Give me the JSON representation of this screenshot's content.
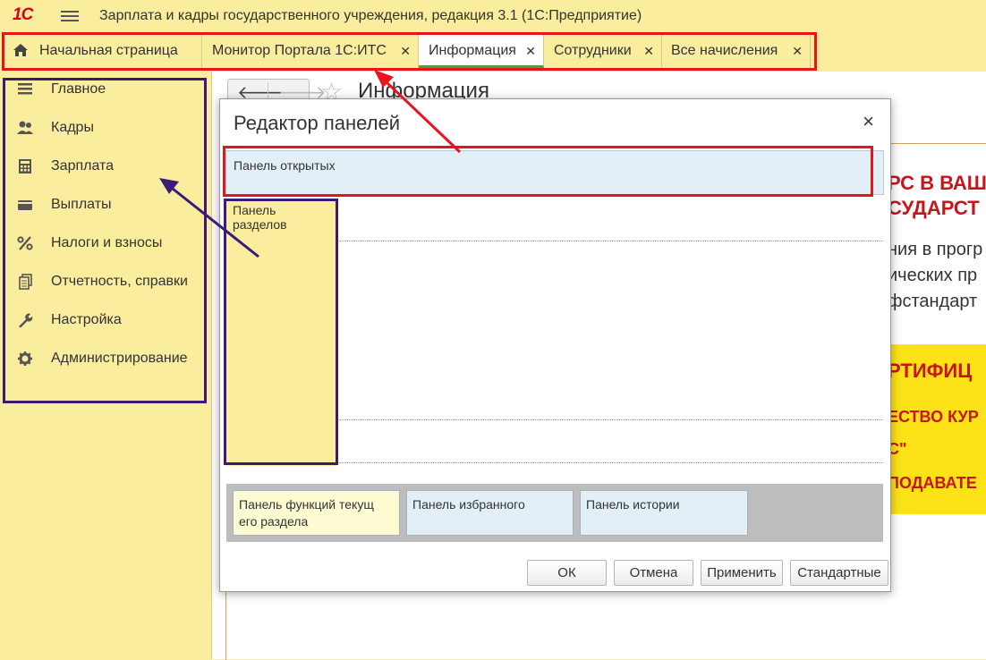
{
  "app": {
    "logo": "1С",
    "title": "Зарплата и кадры государственного учреждения, редакция 3.1  (1С:Предприятие)"
  },
  "tabs": [
    {
      "label": "Начальная страница",
      "closable": false,
      "active": false
    },
    {
      "label": "Монитор Портала 1С:ИТС",
      "closable": true,
      "active": false
    },
    {
      "label": "Информация",
      "closable": true,
      "active": true
    },
    {
      "label": "Сотрудники",
      "closable": true,
      "active": false
    },
    {
      "label": "Все начисления",
      "closable": true,
      "active": false
    }
  ],
  "close_glyph": "✕",
  "sidebar": {
    "items": [
      {
        "label": "Главное",
        "icon": "menu-lines-icon"
      },
      {
        "label": "Кадры",
        "icon": "people-icon"
      },
      {
        "label": "Зарплата",
        "icon": "calculator-icon"
      },
      {
        "label": "Выплаты",
        "icon": "wallet-icon"
      },
      {
        "label": "Налоги и взносы",
        "icon": "percent-icon"
      },
      {
        "label": "Отчетность, справки",
        "icon": "documents-icon"
      },
      {
        "label": "Настройка",
        "icon": "wrench-icon"
      },
      {
        "label": "Администрирование",
        "icon": "gear-icon"
      }
    ]
  },
  "page": {
    "title": "Информация",
    "back": "🡐",
    "forward": "🡒",
    "star": "☆"
  },
  "banner": {
    "line1": "РС В ВАШ",
    "line2": "СУДАРСТ",
    "line3": "ния в прогр",
    "line4": "ических пр",
    "line5": "фстандарт",
    "line6": "РТИФИЦ",
    "line7": "ЕСТВО КУР",
    "line8": "С\"",
    "line9": "ПОДАВАТЕ"
  },
  "dialog": {
    "title": "Редактор панелей",
    "close": "×",
    "panel_open": "Панель открытых",
    "panel_sections": "Панель разделов",
    "panel_functions": "Панель функций текущ его раздела",
    "panel_favorites": "Панель избранного",
    "panel_history": "Панель истории",
    "buttons": {
      "ok": "ОК",
      "cancel": "Отмена",
      "apply": "Применить",
      "default": "Стандартные"
    }
  },
  "colors": {
    "annotation_red": "#e8141c",
    "annotation_purple": "#3b1a7a",
    "app_yellow": "#fbed9e",
    "active_tab_underline": "#3aaa35"
  }
}
